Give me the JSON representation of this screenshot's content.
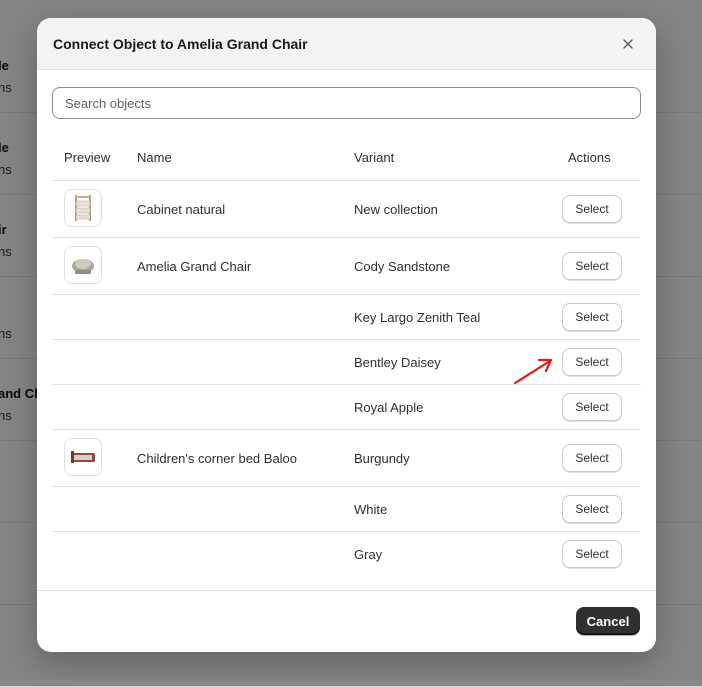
{
  "background": {
    "rows": [
      {
        "title": "le",
        "sub": "ns"
      },
      {
        "title": "le",
        "sub": "ns"
      },
      {
        "title": "ir",
        "sub": "ns"
      },
      {
        "title": "",
        "sub": "ns"
      },
      {
        "title": "and Cl",
        "sub": "ns"
      }
    ]
  },
  "modal": {
    "title": "Connect Object to Amelia Grand Chair",
    "search_placeholder": "Search objects",
    "columns": {
      "preview": "Preview",
      "name": "Name",
      "variant": "Variant",
      "actions": "Actions"
    },
    "rows": [
      {
        "thumb": "cabinet-thumbnail",
        "name": "Cabinet natural",
        "variant": "New collection",
        "action": "Select"
      },
      {
        "thumb": "chair-thumbnail",
        "name": "Amelia Grand Chair",
        "variant": "Cody Sandstone",
        "action": "Select"
      },
      {
        "thumb": "",
        "name": "",
        "variant": "Key Largo Zenith Teal",
        "action": "Select"
      },
      {
        "thumb": "",
        "name": "",
        "variant": "Bentley Daisey",
        "action": "Select"
      },
      {
        "thumb": "",
        "name": "",
        "variant": "Royal Apple",
        "action": "Select"
      },
      {
        "thumb": "bed-thumbnail",
        "name": "Children's corner bed Baloo",
        "variant": "Burgundy",
        "action": "Select"
      },
      {
        "thumb": "",
        "name": "",
        "variant": "White",
        "action": "Select"
      },
      {
        "thumb": "",
        "name": "",
        "variant": "Gray",
        "action": "Select"
      }
    ],
    "cancel_label": "Cancel"
  },
  "colors": {
    "primary_button": "#303030",
    "annotation_arrow": "#e5191b"
  }
}
